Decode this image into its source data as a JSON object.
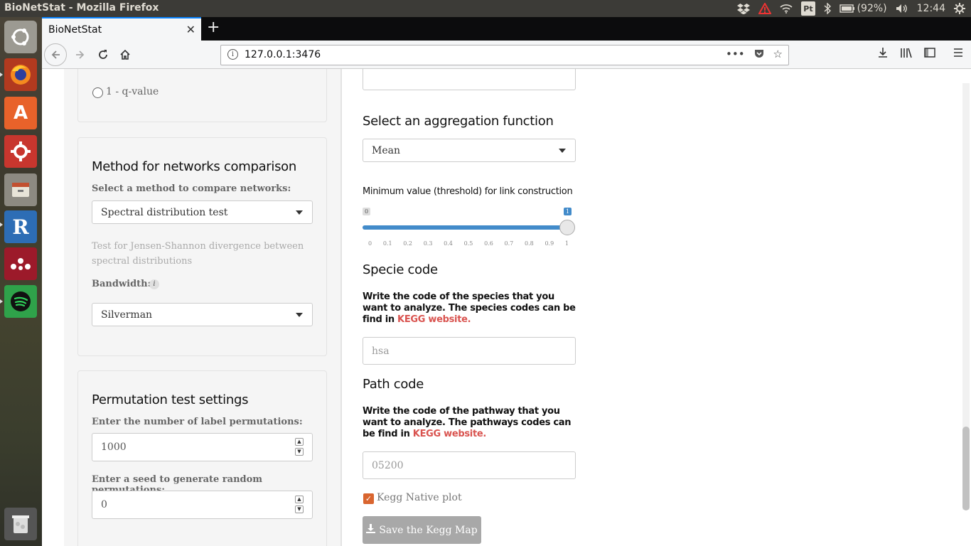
{
  "os": {
    "window_title": "BioNetStat - Mozilla Firefox",
    "battery": "(92%)",
    "clock": "12:44",
    "keyboard": "Pt"
  },
  "browser": {
    "tab_title": "BioNetStat",
    "url": "127.0.0.1:3476",
    "url_menu": "•••"
  },
  "sidebar": {
    "pvalue_option": "1 - q-value",
    "network_comparison": {
      "title": "Method for networks comparison",
      "select_label": "Select a method to compare networks:",
      "selected_method": "Spectral distribution test",
      "description": "Test for Jensen-Shannon divergence between spectral distributions",
      "bandwidth_label": "Bandwidth:",
      "bandwidth_value": "Silverman"
    },
    "permutation": {
      "title": "Permutation test settings",
      "perm_label": "Enter the number of label permutations:",
      "perm_value": "1000",
      "seed_label": "Enter a seed to generate random permutations:",
      "seed_value": "0"
    }
  },
  "main": {
    "aggregation": {
      "title": "Select an aggregation function",
      "selected": "Mean"
    },
    "threshold": {
      "label": "Minimum value (threshold) for link construction",
      "min_badge": "0",
      "value_badge": "1",
      "value": 1,
      "ticks": [
        "0",
        "0.1",
        "0.2",
        "0.3",
        "0.4",
        "0.5",
        "0.6",
        "0.7",
        "0.8",
        "0.9",
        "1"
      ]
    },
    "specie": {
      "title": "Specie code",
      "desc": "Write the code of the species that you want to analyze. The species codes can be find in",
      "link": "KEGG website.",
      "placeholder": "hsa"
    },
    "path": {
      "title": "Path code",
      "desc": "Write the code of the pathway that you want to analyze. The pathways codes can be find in",
      "link": "KEGG website.",
      "placeholder": "05200"
    },
    "kegg_native_label": "Kegg Native plot",
    "kegg_native_checked": true,
    "save_button": "Save the Kegg Map"
  }
}
